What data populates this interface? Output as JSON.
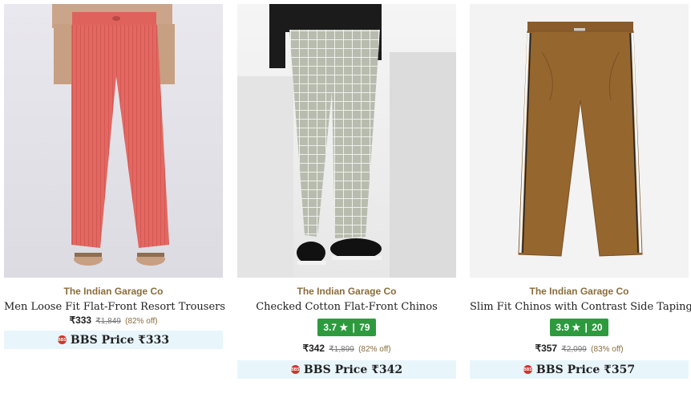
{
  "products": [
    {
      "brand": "The Indian Garage Co",
      "title": "Men Loose Fit Flat-Front Resort Trousers",
      "price": "₹333",
      "mrp": "₹1,849",
      "discount": "(82% off)",
      "bbs_label": "BBS Price ₹333",
      "bbs_logo": "BBS",
      "image_icon": "pink-trousers-image"
    },
    {
      "brand": "The Indian Garage Co",
      "title": "Checked Cotton Flat-Front Chinos",
      "rating": "3.7",
      "rating_star": "★",
      "rating_sep": "|",
      "rating_count": "79",
      "price": "₹342",
      "mrp": "₹1,899",
      "discount": "(82% off)",
      "bbs_label": "BBS Price ₹342",
      "bbs_logo": "BBS",
      "image_icon": "grey-check-chinos-image"
    },
    {
      "brand": "The Indian Garage Co",
      "title": "Slim Fit Chinos with Contrast Side Taping",
      "rating": "3.9",
      "rating_star": "★",
      "rating_sep": "|",
      "rating_count": "20",
      "price": "₹357",
      "mrp": "₹2,099",
      "discount": "(83% off)",
      "bbs_label": "BBS Price ₹357",
      "bbs_logo": "BBS",
      "image_icon": "brown-chinos-image"
    }
  ],
  "colors": {
    "brand_text": "#8a6d3b",
    "rating_badge": "#2e9a3e",
    "bbs_bg": "#e8f6fc",
    "bbs_logo": "#d0342c"
  }
}
